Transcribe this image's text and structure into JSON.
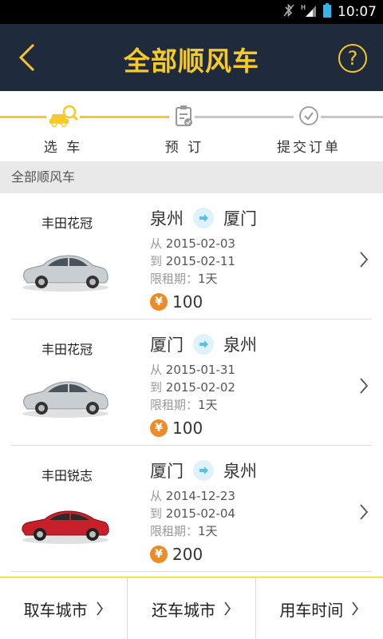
{
  "status_bar": {
    "time": "10:07"
  },
  "nav": {
    "title": "全部顺风车",
    "help_label": "?"
  },
  "steps": [
    {
      "label": "选 车",
      "icon": "car-search-icon",
      "active": true
    },
    {
      "label": "预 订",
      "icon": "clipboard-check-icon",
      "active": false
    },
    {
      "label": "提交订单",
      "icon": "check-circle-icon",
      "active": false
    }
  ],
  "section": {
    "title": "全部顺风车"
  },
  "listings": [
    {
      "car": "丰田花冠",
      "from_city": "泉州",
      "to_city": "厦门",
      "from_label": "从",
      "from_date": "2015-02-03",
      "to_label": "到",
      "to_date": "2015-02-11",
      "limit_label": "限租期：",
      "limit_value": "1天",
      "price": "100",
      "car_color": "#c9ced3"
    },
    {
      "car": "丰田花冠",
      "from_city": "厦门",
      "to_city": "泉州",
      "from_label": "从",
      "from_date": "2015-01-31",
      "to_label": "到",
      "to_date": "2015-02-02",
      "limit_label": "限租期：",
      "limit_value": "1天",
      "price": "100",
      "car_color": "#c9ced3"
    },
    {
      "car": "丰田锐志",
      "from_city": "厦门",
      "to_city": "泉州",
      "from_label": "从",
      "from_date": "2014-12-23",
      "to_label": "到",
      "to_date": "2015-02-04",
      "limit_label": "限租期：",
      "limit_value": "1天",
      "price": "200",
      "car_color": "#c8202a"
    }
  ],
  "currency_symbol": "¥",
  "bottom_bar": {
    "pickup_city": "取车城市",
    "return_city": "还车城市",
    "use_time": "用车时间"
  },
  "colors": {
    "nav_bg": "#1f2b3d",
    "accent": "#f4c928",
    "price_badge": "#f08a24"
  }
}
